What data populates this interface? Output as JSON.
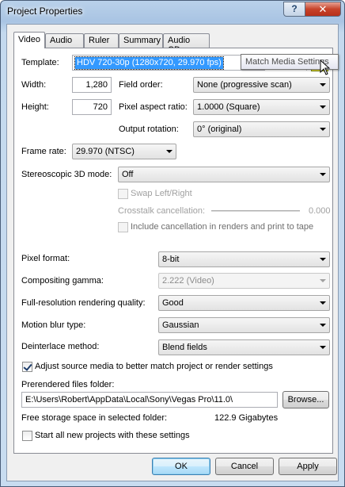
{
  "window": {
    "title": "Project Properties",
    "help_label": "?",
    "close_label": "✕"
  },
  "tabs": [
    {
      "label": "Video",
      "active": true
    },
    {
      "label": "Audio",
      "active": false
    },
    {
      "label": "Ruler",
      "active": false
    },
    {
      "label": "Summary",
      "active": false
    },
    {
      "label": "Audio CD",
      "active": false
    }
  ],
  "template": {
    "label": "Template:",
    "value": "HDV 720-30p (1280x720, 29.970 fps)",
    "save_icon": "floppy-disk-icon",
    "delete_icon": "delete-x-icon",
    "match_icon": "match-media-icon",
    "tooltip": "Match Media Settings"
  },
  "width": {
    "label": "Width:",
    "value": "1,280"
  },
  "height": {
    "label": "Height:",
    "value": "720"
  },
  "field_order": {
    "label": "Field order:",
    "value": "None (progressive scan)"
  },
  "pixel_aspect": {
    "label": "Pixel aspect ratio:",
    "value": "1.0000 (Square)"
  },
  "output_rotation": {
    "label": "Output rotation:",
    "value": "0° (original)"
  },
  "frame_rate": {
    "label": "Frame rate:",
    "value": "29.970 (NTSC)"
  },
  "stereo": {
    "label": "Stereoscopic 3D mode:",
    "value": "Off"
  },
  "swap": {
    "label": "Swap Left/Right",
    "checked": false,
    "disabled": true
  },
  "crosstalk": {
    "label": "Crosstalk cancellation:",
    "value": "0.000"
  },
  "include_cancellation": {
    "label": "Include cancellation in renders and print to tape",
    "checked": false,
    "disabled": true
  },
  "pixel_format": {
    "label": "Pixel format:",
    "value": "8-bit"
  },
  "compositing_gamma": {
    "label": "Compositing gamma:",
    "value": "2.222 (Video)"
  },
  "render_quality": {
    "label": "Full-resolution rendering quality:",
    "value": "Good"
  },
  "motion_blur": {
    "label": "Motion blur type:",
    "value": "Gaussian"
  },
  "deinterlace": {
    "label": "Deinterlace method:",
    "value": "Blend fields"
  },
  "adjust_source": {
    "label": "Adjust source media to better match project or render settings",
    "checked": true
  },
  "prerendered": {
    "label": "Prerendered files folder:",
    "path": "E:\\Users\\Robert\\AppData\\Local\\Sony\\Vegas Pro\\11.0\\",
    "browse_label": "Browse..."
  },
  "free_storage": {
    "label": "Free storage space in selected folder:",
    "value": "122.9 Gigabytes"
  },
  "start_all": {
    "label": "Start all new projects with these settings",
    "checked": false
  },
  "buttons": {
    "ok": "OK",
    "cancel": "Cancel",
    "apply": "Apply"
  }
}
